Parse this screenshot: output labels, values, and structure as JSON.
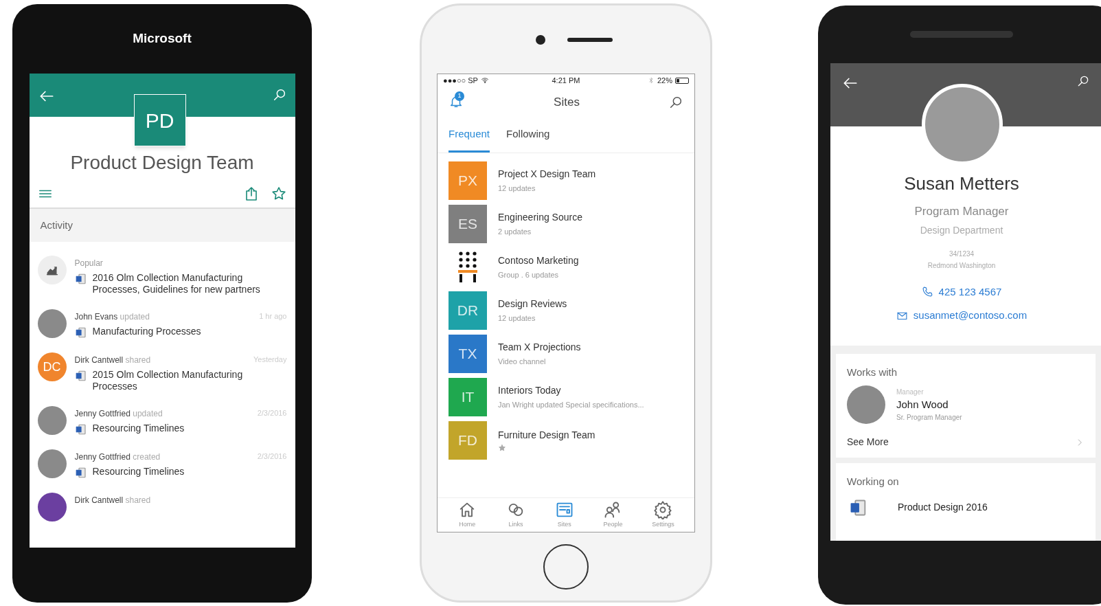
{
  "team_site_phone": {
    "brand": "Microsoft",
    "site_initials": "PD",
    "site_title": "Product Design Team",
    "section_label": "Activity",
    "activity": [
      {
        "kind": "trending",
        "label": "Popular",
        "doc": "2016 Olm Collection Manufacturing Processes, Guidelines for new partners"
      },
      {
        "kind": "photo",
        "actor": "John Evans",
        "action": "updated",
        "time": "1 hr ago",
        "doc": "Manufacturing Processes"
      },
      {
        "kind": "initials",
        "initials": "DC",
        "color": "#f0852d",
        "actor": "Dirk Cantwell",
        "action": "shared",
        "time": "Yesterday",
        "doc": "2015 Olm Collection Manufacturing Processes"
      },
      {
        "kind": "photo",
        "actor": "Jenny Gottfried",
        "action": "updated",
        "time": "2/3/2016",
        "doc": "Resourcing Timelines"
      },
      {
        "kind": "photo",
        "actor": "Jenny Gottfried",
        "action": "created",
        "time": "2/3/2016",
        "doc": "Resourcing Timelines"
      },
      {
        "kind": "initials",
        "color": "#6b3fa0",
        "actor": "Dirk Cantwell",
        "action": "shared"
      }
    ]
  },
  "sites_phone": {
    "status_bar": {
      "carrier": "●●●○○ SP",
      "time": "4:21 PM",
      "battery": "22%"
    },
    "notification_count": "1",
    "title": "Sites",
    "tabs": [
      {
        "label": "Frequent",
        "selected": true
      },
      {
        "label": "Following",
        "selected": false
      }
    ],
    "sites": [
      {
        "kind": "initials",
        "initials": "PX",
        "color": "#f08a24",
        "name": "Project X Design Team",
        "subtitle": "12 updates",
        "favorite": false
      },
      {
        "kind": "initials",
        "initials": "ES",
        "color": "#7f7f7f",
        "name": "Engineering Source",
        "subtitle": "2 updates",
        "favorite": false
      },
      {
        "kind": "logo",
        "name": "Contoso Marketing",
        "subtitle": "Group . 6 updates",
        "favorite": false
      },
      {
        "kind": "initials",
        "initials": "DR",
        "color": "#1ea2a8",
        "name": "Design Reviews",
        "subtitle": "12 updates",
        "favorite": false
      },
      {
        "kind": "initials",
        "initials": "TX",
        "color": "#2a78c8",
        "name": "Team X Projections",
        "subtitle": "Video channel",
        "favorite": false
      },
      {
        "kind": "initials",
        "initials": "IT",
        "color": "#1fa84f",
        "name": "Interiors Today",
        "subtitle": "Jan Wright updated Special specifications...",
        "favorite": false
      },
      {
        "kind": "initials",
        "initials": "FD",
        "color": "#c2a52a",
        "name": "Furniture Design Team",
        "favorite": true
      }
    ],
    "nav": [
      {
        "kind": "home",
        "label": "Home",
        "selected": false
      },
      {
        "kind": "links",
        "label": "Links",
        "selected": false
      },
      {
        "kind": "sites",
        "label": "Sites",
        "selected": true
      },
      {
        "kind": "people",
        "label": "People",
        "selected": false
      },
      {
        "kind": "settings",
        "label": "Settings",
        "selected": false
      }
    ]
  },
  "profile_phone": {
    "name": "Susan Metters",
    "job_title": "Program Manager",
    "department": "Design Department",
    "office": "34/1234",
    "location": "Redmond Washington",
    "phone": "425 123 4567",
    "email": "susanmet@contoso.com",
    "works_with": {
      "heading": "Works with",
      "role": "Manager",
      "name": "John Wood",
      "job_title": "Sr. Program Manager",
      "see_more": "See More"
    },
    "working_on": {
      "heading": "Working on",
      "items": [
        "Product Design 2016"
      ]
    }
  }
}
